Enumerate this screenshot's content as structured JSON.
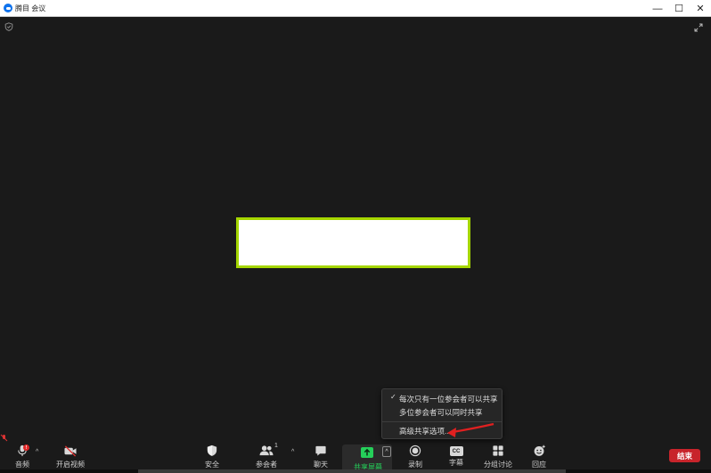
{
  "window": {
    "title": "腾目 会议",
    "minimize": "—",
    "maximize": "☐",
    "close": "✕"
  },
  "share_menu": {
    "items": [
      {
        "label": "每次只有一位参会者可以共享",
        "checked": true
      },
      {
        "label": "多位参会者可以同时共享",
        "checked": false
      }
    ],
    "advanced": "高级共享选项..."
  },
  "toolbar": {
    "audio": "音频",
    "audio_badge": "!",
    "video": "开启视频",
    "security": "安全",
    "participants": "参会者",
    "participants_count": "1",
    "chat": "聊天",
    "share": "共享屏幕",
    "record": "录制",
    "captions": "字幕",
    "captions_icon": "CC",
    "breakout": "分组讨论",
    "reactions": "回应",
    "end": "结束"
  },
  "colors": {
    "accent_green": "#25d05a",
    "share_border": "#a5d600",
    "end_red": "#c8242b",
    "annotation_arrow": "#e02020"
  }
}
